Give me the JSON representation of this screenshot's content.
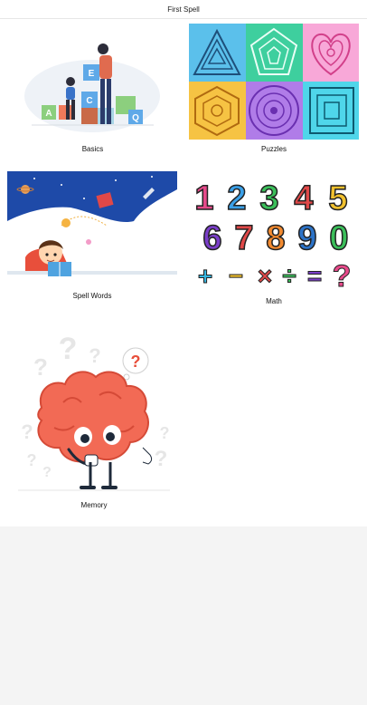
{
  "app": {
    "title": "First Spell"
  },
  "categories": [
    {
      "label": "Basics",
      "blocks": [
        "E",
        "C",
        "A",
        "Q"
      ]
    },
    {
      "label": "Puzzles"
    },
    {
      "label": "Spell Words"
    },
    {
      "label": "Math",
      "digits": [
        "1",
        "2",
        "3",
        "4",
        "5",
        "6",
        "7",
        "8",
        "9",
        "0"
      ],
      "operators": [
        "+",
        "−",
        "×",
        "÷",
        "=",
        "?"
      ]
    },
    {
      "label": "Memory",
      "symbol": "?"
    }
  ]
}
